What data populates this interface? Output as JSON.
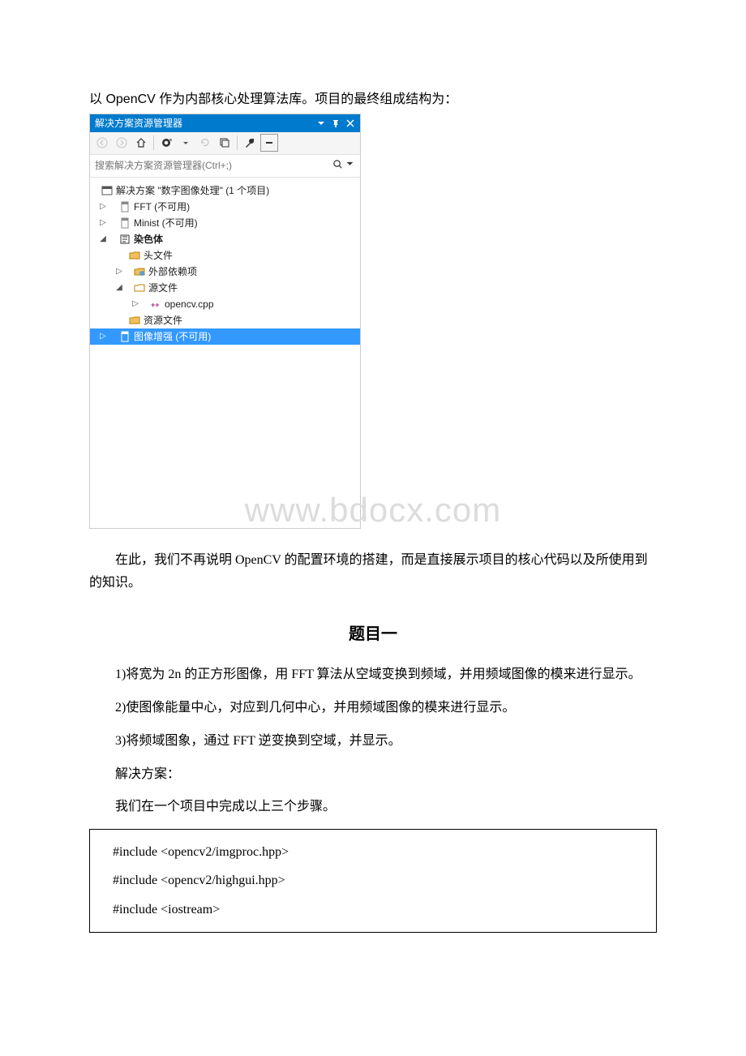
{
  "intro_text": "以 OpenCV 作为内部核心处理算法库。项目的最终组成结构为：",
  "vs": {
    "title": "解决方案资源管理器",
    "search_placeholder": "搜索解决方案资源管理器(Ctrl+;)",
    "solution_label": "解决方案 \"数字图像处理\" (1 个项目)",
    "nodes": {
      "fft": "FFT (不可用)",
      "minist": "Minist (不可用)",
      "chromosome": "染色体",
      "headers": "头文件",
      "ext_deps": "外部依赖项",
      "src": "源文件",
      "cpp": "opencv.cpp",
      "res": "资源文件",
      "img_enh": "图像增强 (不可用)"
    }
  },
  "watermark": "www.bdocx.com",
  "para_after_panel": "在此，我们不再说明 OpenCV 的配置环境的搭建，而是直接展示项目的核心代码以及所使用到的知识。",
  "section_title": "题目一",
  "q1": "1)将宽为 2n 的正方形图像，用 FFT 算法从空域变换到频域，并用频域图像的模来进行显示。",
  "q2": "2)使图像能量中心，对应到几何中心，并用频域图像的模来进行显示。",
  "q3": "3)将频域图象，通过 FFT 逆变换到空域，并显示。",
  "soln_label": "解决方案：",
  "soln_desc": "我们在一个项目中完成以上三个步骤。",
  "code": {
    "l1": "#include <opencv2/imgproc.hpp>",
    "l2": "#include <opencv2/highgui.hpp>",
    "l3": "#include <iostream>"
  }
}
